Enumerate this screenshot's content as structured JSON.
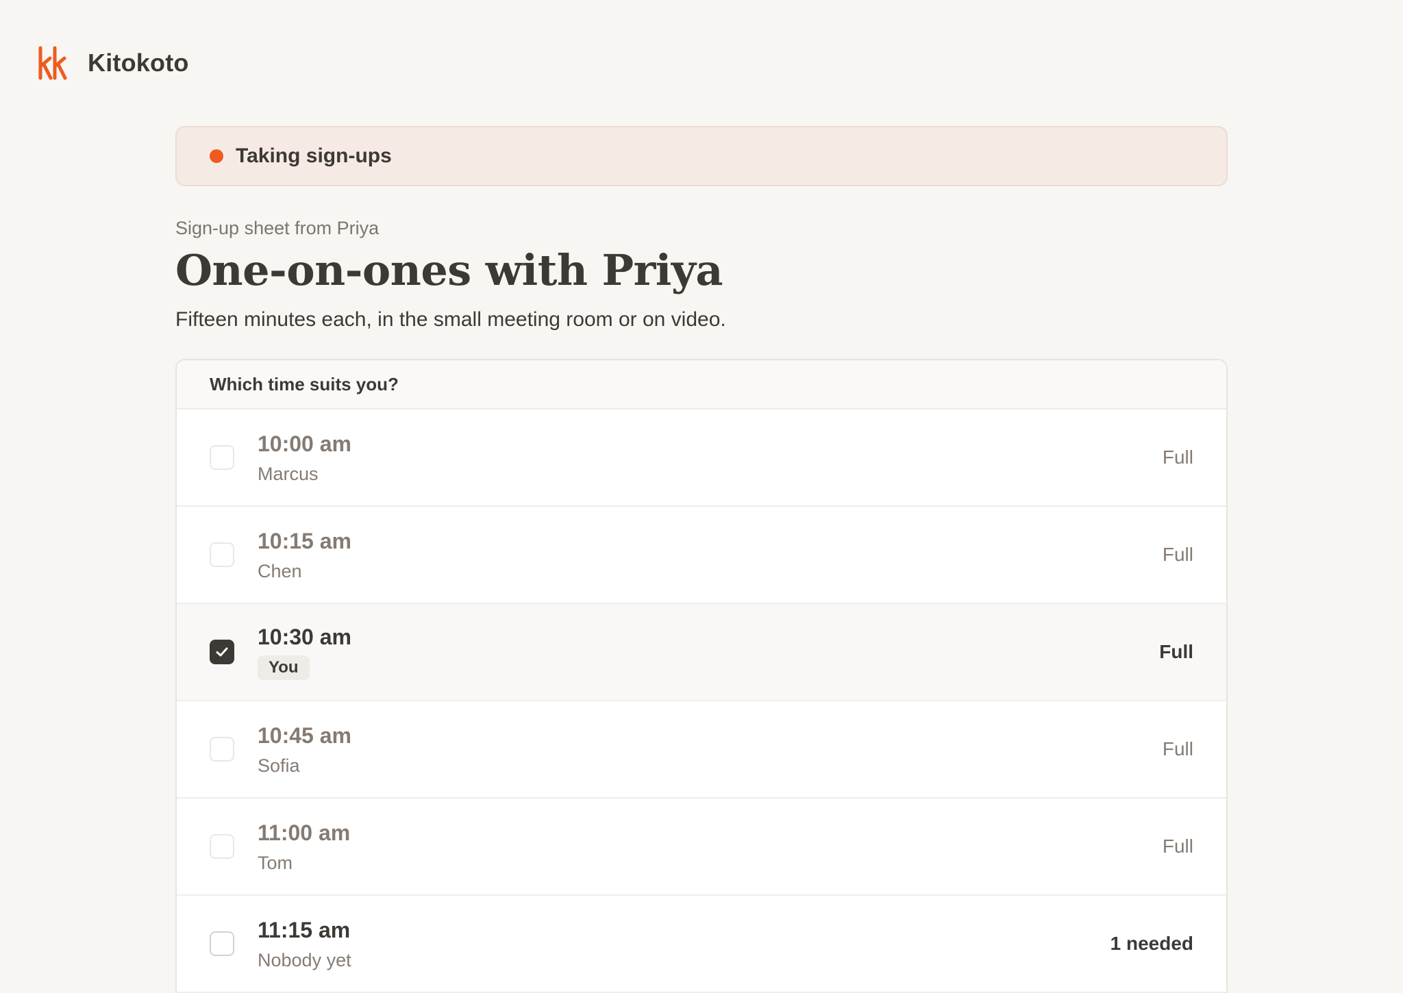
{
  "app": {
    "name": "Kitokoto",
    "logo": "kk-logo-icon",
    "accent_color": "#f05a1e"
  },
  "status": {
    "label": "Taking sign-ups",
    "color": "#f05a1e"
  },
  "sheet": {
    "subtitle": "Sign-up sheet from Priya",
    "title": "One-on-ones with Priya",
    "description": "Fifteen minutes each, in the small meeting room or on video."
  },
  "slots": {
    "heading": "Which time suits you?",
    "items": [
      {
        "time": "10:00 am",
        "person": "Marcus",
        "status": "Full",
        "checked": false
      },
      {
        "time": "10:15 am",
        "person": "Chen",
        "status": "Full",
        "checked": false
      },
      {
        "time": "10:30 am",
        "person": "You",
        "status": "Full",
        "checked": true
      },
      {
        "time": "10:45 am",
        "person": "Sofia",
        "status": "Full",
        "checked": false
      },
      {
        "time": "11:00 am",
        "person": "Tom",
        "status": "Full",
        "checked": false
      },
      {
        "time": "11:15 am",
        "person": "Nobody yet",
        "status": "1 needed",
        "checked": false
      }
    ]
  }
}
